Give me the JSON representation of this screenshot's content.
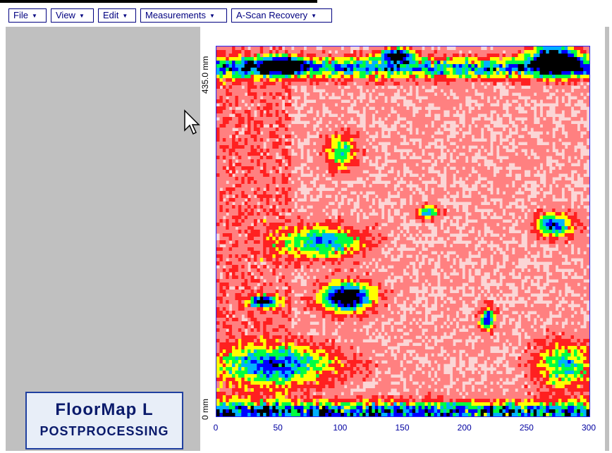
{
  "menu": [
    {
      "label": "File"
    },
    {
      "label": "View"
    },
    {
      "label": "Edit"
    },
    {
      "label": "Measurements"
    },
    {
      "label": "A-Scan Recovery"
    }
  ],
  "logo": {
    "line1": "FloorMap L",
    "line2": "POSTPROCESSING"
  },
  "icons": {
    "cursor": "arrow-pointer-icon",
    "menu_caret": "caret-down-icon"
  },
  "colors": {
    "menu_border": "#000080",
    "plot_border": "#2020ff",
    "tick_text": "#0000a0",
    "app_bg": "#c0c0c0"
  },
  "chart_data": {
    "type": "heatmap",
    "x_ticks": [
      "0",
      "50",
      "100",
      "150",
      "200",
      "250",
      "300"
    ],
    "xlim": [
      0,
      300
    ],
    "y_labels": {
      "top": "435.0 mm",
      "bottom": "0 mm"
    },
    "ylim": [
      0,
      435
    ],
    "colormap": [
      "#ffe4e4",
      "#ff8080",
      "#ff2020",
      "#ffff00",
      "#00ff40",
      "#00b0ff",
      "#0000ff",
      "#000000"
    ],
    "features": [
      {
        "kind": "band",
        "y_center": 410,
        "intensity": 0.7
      },
      {
        "kind": "band",
        "y_center": 5,
        "intensity": 0.8
      },
      {
        "kind": "blob",
        "x": 52,
        "y": 412,
        "rx": 18,
        "ry": 9,
        "intensity": 1.0
      },
      {
        "kind": "blob",
        "x": 272,
        "y": 420,
        "rx": 20,
        "ry": 18,
        "intensity": 1.0
      },
      {
        "kind": "blob",
        "x": 145,
        "y": 425,
        "rx": 14,
        "ry": 8,
        "intensity": 0.85
      },
      {
        "kind": "blob",
        "x": 105,
        "y": 140,
        "rx": 22,
        "ry": 18,
        "intensity": 1.0
      },
      {
        "kind": "blob",
        "x": 38,
        "y": 135,
        "rx": 12,
        "ry": 7,
        "intensity": 0.95
      },
      {
        "kind": "blob",
        "x": 272,
        "y": 225,
        "rx": 16,
        "ry": 14,
        "intensity": 0.7
      },
      {
        "kind": "blob",
        "x": 218,
        "y": 115,
        "rx": 6,
        "ry": 14,
        "intensity": 0.75
      },
      {
        "kind": "blob",
        "x": 85,
        "y": 205,
        "rx": 35,
        "ry": 20,
        "intensity": 0.6
      },
      {
        "kind": "blob",
        "x": 100,
        "y": 310,
        "rx": 14,
        "ry": 22,
        "intensity": 0.45
      },
      {
        "kind": "blob",
        "x": 170,
        "y": 240,
        "rx": 10,
        "ry": 8,
        "intensity": 0.55
      },
      {
        "kind": "blob",
        "x": 50,
        "y": 60,
        "rx": 50,
        "ry": 25,
        "intensity": 0.6
      },
      {
        "kind": "blob",
        "x": 280,
        "y": 60,
        "rx": 25,
        "ry": 30,
        "intensity": 0.5
      }
    ]
  }
}
